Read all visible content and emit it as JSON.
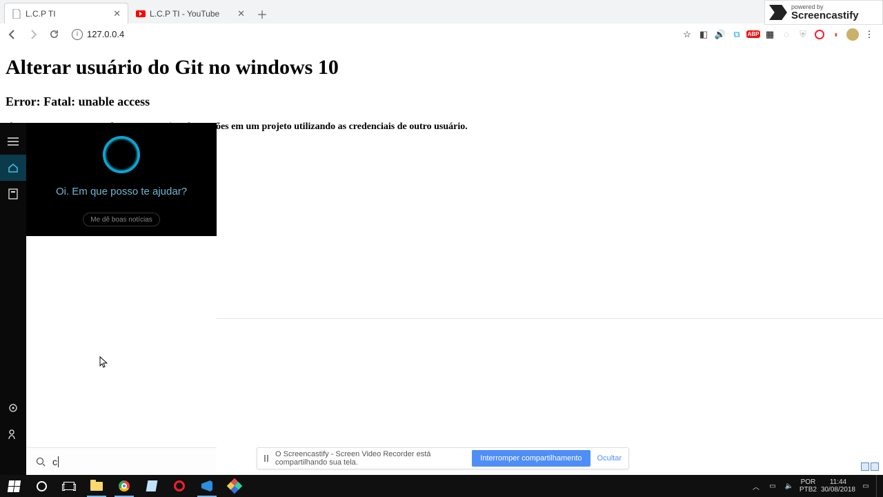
{
  "browser": {
    "tabs": [
      {
        "title": "L.C.P TI",
        "active": true
      },
      {
        "title": "L.C.P TI - YouTube",
        "active": false
      }
    ],
    "address": "127.0.0.4"
  },
  "screencastify": {
    "powered_by": "powered by",
    "brand": "Screencastify",
    "message": "O Screencastify - Screen Video Recorder está compartilhando sua tela.",
    "stop": "Interromper compartilhamento",
    "hide": "Ocultar"
  },
  "page": {
    "h1": "Alterar usuário do Git no windows 10",
    "h2": "Error: Fatal: unable access",
    "p": "obs. O error ocorre quando se tenta enviar alterarções em um projeto utilizando as credenciais de outro usuário."
  },
  "cortana": {
    "greeting": "Oi. Em que posso te ajudar?",
    "suggestion": "Me dê boas notícias",
    "query": "c"
  },
  "taskbar": {
    "ime1": "POR",
    "ime2": "PTB2",
    "time": "11:44",
    "date": "30/08/2018"
  }
}
